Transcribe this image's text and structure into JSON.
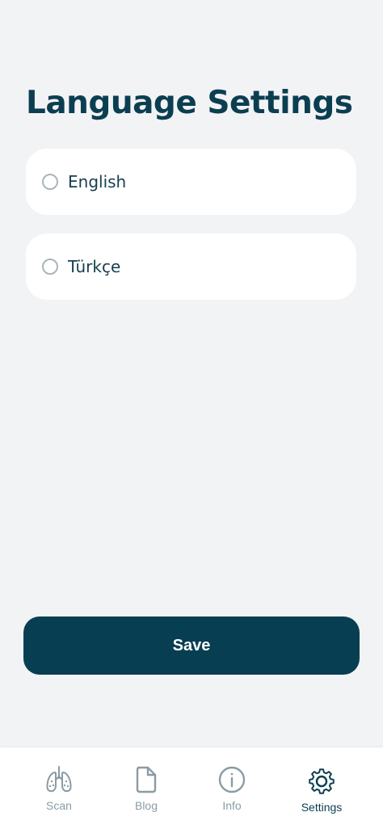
{
  "page": {
    "title": "Language Settings"
  },
  "languages": [
    {
      "label": "English",
      "selected": false
    },
    {
      "label": "Türkçe",
      "selected": false
    }
  ],
  "save_label": "Save",
  "nav": {
    "items": [
      {
        "label": "Scan",
        "icon": "lungs-icon",
        "active": false
      },
      {
        "label": "Blog",
        "icon": "document-icon",
        "active": false
      },
      {
        "label": "Info",
        "icon": "info-icon",
        "active": false
      },
      {
        "label": "Settings",
        "icon": "gear-icon",
        "active": true
      }
    ]
  },
  "colors": {
    "primary": "#073e52",
    "background": "#f2f3f5",
    "card": "#ffffff",
    "inactive_nav": "#8a9ca3",
    "radio_border": "#a9b5ba"
  }
}
